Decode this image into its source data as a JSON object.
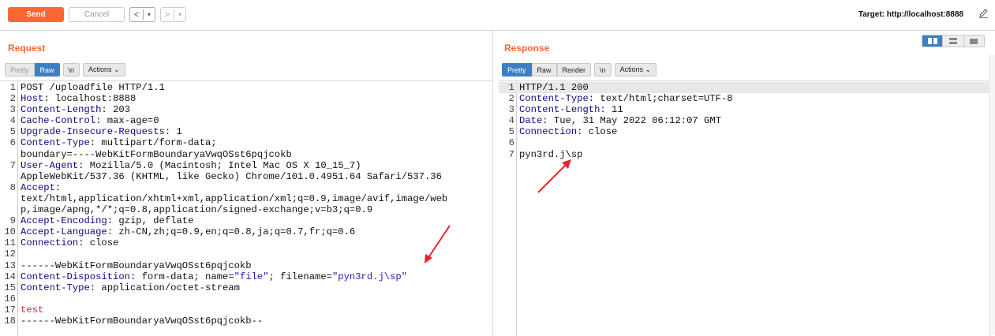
{
  "toolbar": {
    "send_label": "Send",
    "cancel_label": "Cancel",
    "back_label": "<",
    "forward_label": ">",
    "dropdown": "▾",
    "target_label": "Target: http://localhost:8888"
  },
  "request": {
    "title": "Request",
    "tabs": {
      "pretty": "Pretty",
      "raw": "Raw",
      "newline": "\\n",
      "actions": "Actions ⌄"
    },
    "active_tab": "Raw"
  },
  "response": {
    "title": "Response",
    "tabs": {
      "pretty": "Pretty",
      "raw": "Raw",
      "render": "Render",
      "newline": "\\n",
      "actions": "Actions ⌄"
    },
    "active_tab": "Pretty"
  },
  "request_lines": [
    {
      "n": "1",
      "key": "",
      "val": "POST /uploadfile HTTP/1.1"
    },
    {
      "n": "2",
      "key": "Host",
      "val": " localhost:8888"
    },
    {
      "n": "3",
      "key": "Content-Length",
      "val": " 203"
    },
    {
      "n": "4",
      "key": "Cache-Control",
      "val": " max-age=0"
    },
    {
      "n": "5",
      "key": "Upgrade-Insecure-Requests",
      "val": " 1"
    },
    {
      "n": "6",
      "key": "Content-Type",
      "val": " multipart/form-data;"
    },
    {
      "n": "",
      "key": "",
      "val": "boundary=----WebKitFormBoundaryaVwqOSst6pqjcokb"
    },
    {
      "n": "7",
      "key": "User-Agent",
      "val": " Mozilla/5.0 (Macintosh; Intel Mac OS X 10_15_7)"
    },
    {
      "n": "",
      "key": "",
      "val": "AppleWebKit/537.36 (KHTML, like Gecko) Chrome/101.0.4951.64 Safari/537.36"
    },
    {
      "n": "8",
      "key": "Accept",
      "val": ""
    },
    {
      "n": "",
      "key": "",
      "val": "text/html,application/xhtml+xml,application/xml;q=0.9,image/avif,image/web"
    },
    {
      "n": "",
      "key": "",
      "val": "p,image/apng,*/*;q=0.8,application/signed-exchange;v=b3;q=0.9"
    },
    {
      "n": "9",
      "key": "Accept-Encoding",
      "val": " gzip, deflate"
    },
    {
      "n": "10",
      "key": "Accept-Language",
      "val": " zh-CN,zh;q=0.9,en;q=0.8,ja;q=0.7,fr;q=0.6"
    },
    {
      "n": "11",
      "key": "Connection",
      "val": " close"
    },
    {
      "n": "12",
      "key": "",
      "val": ""
    },
    {
      "n": "13",
      "key": "",
      "val": "------WebKitFormBoundaryaVwqOSst6pqjcokb"
    },
    {
      "n": "14",
      "key": "Content-Disposition",
      "val": " form-data; name=",
      "s1": "\"file\"",
      "mid": "; filename=",
      "s2": "\"pyn3rd.j\\sp\""
    },
    {
      "n": "15",
      "key": "Content-Type",
      "val": " application/octet-stream"
    },
    {
      "n": "16",
      "key": "",
      "val": ""
    },
    {
      "n": "17",
      "key": "",
      "val": "",
      "red": "test"
    },
    {
      "n": "18",
      "key": "",
      "val": "------WebKitFormBoundaryaVwqOSst6pqjcokb--"
    }
  ],
  "response_lines": [
    {
      "n": "1",
      "key": "",
      "val": "HTTP/1.1 200"
    },
    {
      "n": "2",
      "key": "Content-Type",
      "val": " text/html;charset=UTF-8"
    },
    {
      "n": "3",
      "key": "Content-Length",
      "val": " 11"
    },
    {
      "n": "4",
      "key": "Date",
      "val": " Tue, 31 May 2022 06:12:07 GMT"
    },
    {
      "n": "5",
      "key": "Connection",
      "val": " close"
    },
    {
      "n": "6",
      "key": "",
      "val": ""
    },
    {
      "n": "7",
      "key": "",
      "val": "pyn3rd.j\\sp"
    }
  ],
  "colors": {
    "accent": "#ff6633",
    "tab_active": "#3c7fc4",
    "header_key": "#0a0a80",
    "annotation_arrow": "#e8232a"
  }
}
